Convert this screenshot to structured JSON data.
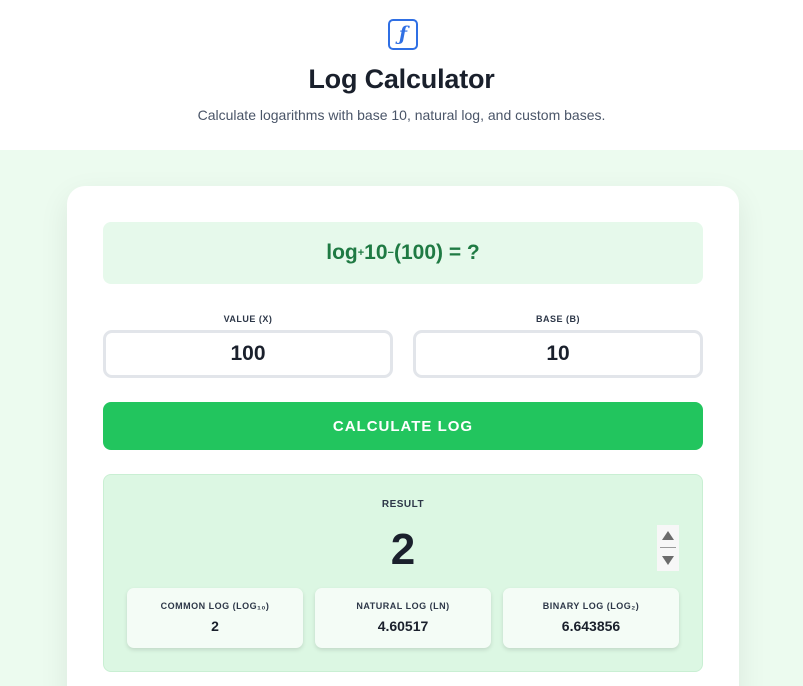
{
  "header": {
    "logo_glyph": "ƒ",
    "title": "Log Calculator",
    "subtitle": "Calculate logarithms with base 10, natural log, and custom bases."
  },
  "formula": {
    "prefix": "log",
    "sub_open": "+",
    "base": "10",
    "sub_close": "−",
    "argument": "(100)",
    "suffix": " = ?"
  },
  "inputs": {
    "value_label": "VALUE (X)",
    "value": "100",
    "base_label": "BASE (B)",
    "base": "10"
  },
  "button": {
    "label": "CALCULATE LOG"
  },
  "result": {
    "label": "RESULT",
    "value": "2",
    "common": {
      "label": "COMMON LOG (LOG₁₀)",
      "value": "2"
    },
    "natural": {
      "label": "NATURAL LOG (LN)",
      "value": "4.60517"
    },
    "binary": {
      "label": "BINARY LOG (LOG₂)",
      "value": "6.643856"
    }
  },
  "colors": {
    "accent": "#22c55e",
    "logo": "#2f6fe4",
    "formula_text": "#1f7a43",
    "page_background": "#ecfbef"
  }
}
